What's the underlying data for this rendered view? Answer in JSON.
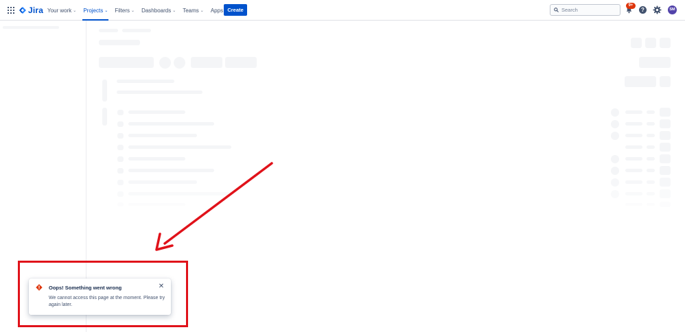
{
  "app": {
    "name": "Jira"
  },
  "nav": [
    {
      "label": "Your work",
      "active": false
    },
    {
      "label": "Projects",
      "active": true
    },
    {
      "label": "Filters",
      "active": false
    },
    {
      "label": "Dashboards",
      "active": false
    },
    {
      "label": "Teams",
      "active": false
    },
    {
      "label": "Apps",
      "active": false
    }
  ],
  "create_label": "Create",
  "search": {
    "placeholder": "Search"
  },
  "notifications": {
    "badge": "9+"
  },
  "help_glyph": "?",
  "user": {
    "initials": "SM"
  },
  "toast": {
    "title": "Oops! Something went wrong",
    "message": "We cannot access this page at the moment. Please try again later.",
    "close_glyph": "✕"
  },
  "colors": {
    "brand": "#0052cc",
    "error": "#de350b",
    "annotation": "#e0121a",
    "avatar": "#5243aa"
  },
  "icons": [
    "app-switcher-icon",
    "jira-logo-icon",
    "search-icon",
    "bell-icon",
    "help-icon",
    "gear-icon",
    "error-icon",
    "close-icon",
    "annotation-arrow"
  ]
}
